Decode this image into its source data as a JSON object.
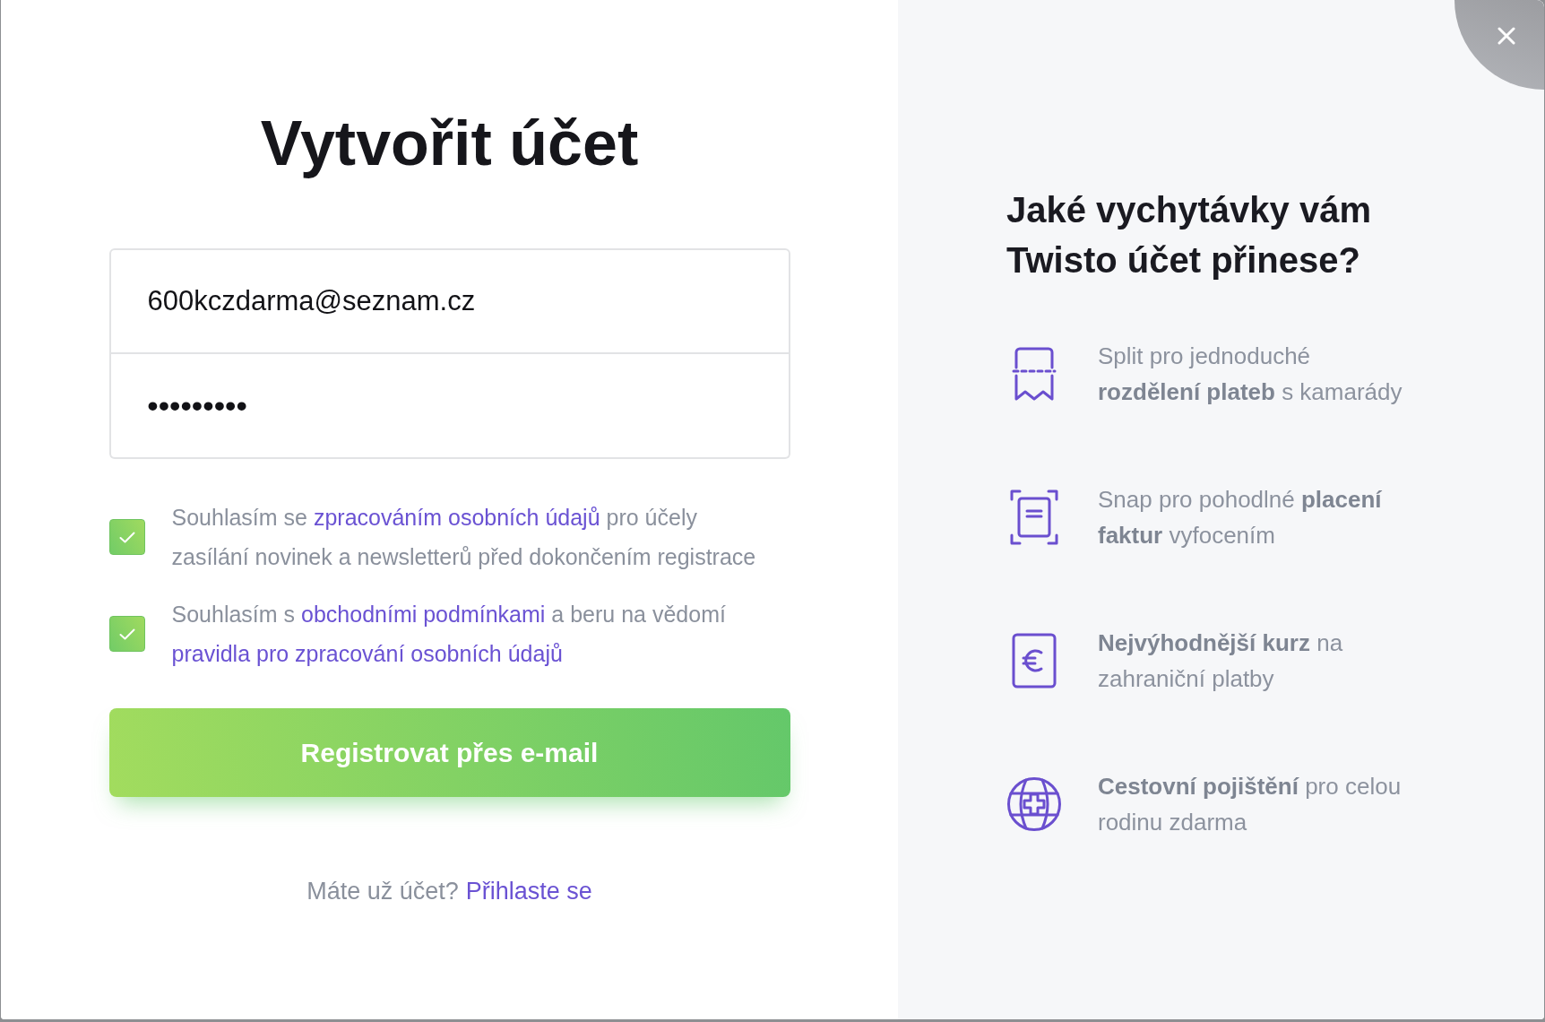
{
  "title": "Vytvořit účet",
  "form": {
    "email": {
      "value": "600kczdarma@seznam.cz"
    },
    "password": {
      "value": "•••••••••"
    }
  },
  "consents": [
    {
      "checked": true,
      "parts": [
        {
          "kind": "text",
          "text": "Souhlasím se "
        },
        {
          "kind": "link",
          "text": "zpracováním osobních údajů"
        },
        {
          "kind": "text",
          "text": " pro účely zasílání novinek a newsletterů před dokončením registrace"
        }
      ]
    },
    {
      "checked": true,
      "parts": [
        {
          "kind": "text",
          "text": "Souhlasím s "
        },
        {
          "kind": "link",
          "text": "obchodními podmínkami"
        },
        {
          "kind": "text",
          "text": " a beru na vědomí "
        },
        {
          "kind": "link",
          "text": "pravidla pro zpracování osobních údajů"
        }
      ]
    }
  ],
  "submit_button": "Registrovat přes e-mail",
  "login_prompt": {
    "text": "Máte už účet?",
    "link": "Přihlaste se"
  },
  "benefits": {
    "heading": "Jaké vychytávky vám Twisto účet přinese?",
    "items": [
      {
        "kind": "split",
        "text": "Split pro jednoduché **rozdělení plateb** s kamarády"
      },
      {
        "kind": "snap",
        "text": "Snap pro pohodlné **placení faktur** vyfocením"
      },
      {
        "kind": "currency",
        "text": "**Nejvýhodnější kurz** na zahraniční platby"
      },
      {
        "kind": "insurance",
        "text": "**Cestovní pojištění** pro celou rodinu zdarma"
      }
    ]
  }
}
